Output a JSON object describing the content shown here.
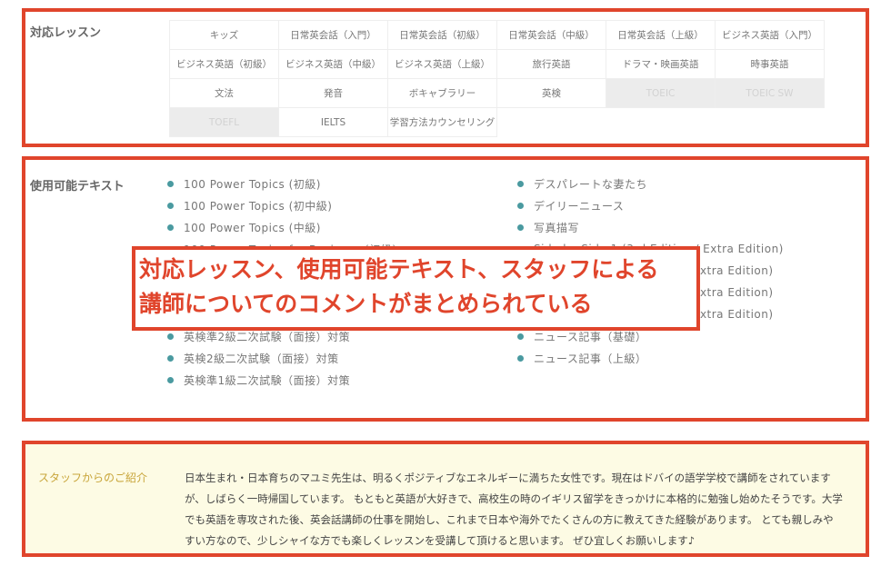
{
  "lessons": {
    "label": "対応レッスン",
    "items": [
      {
        "t": "キッズ",
        "on": true
      },
      {
        "t": "日常英会話（入門）",
        "on": true
      },
      {
        "t": "日常英会話（初級）",
        "on": true
      },
      {
        "t": "日常英会話（中級）",
        "on": true
      },
      {
        "t": "日常英会話（上級）",
        "on": true
      },
      {
        "t": "ビジネス英語（入門）",
        "on": true
      },
      {
        "t": "ビジネス英語（初級）",
        "on": true
      },
      {
        "t": "ビジネス英語（中級）",
        "on": true
      },
      {
        "t": "ビジネス英語（上級）",
        "on": true
      },
      {
        "t": "旅行英語",
        "on": true
      },
      {
        "t": "ドラマ・映画英語",
        "on": true
      },
      {
        "t": "時事英語",
        "on": true
      },
      {
        "t": "文法",
        "on": true
      },
      {
        "t": "発音",
        "on": true
      },
      {
        "t": "ボキャブラリー",
        "on": true
      },
      {
        "t": "英検",
        "on": true
      },
      {
        "t": "TOEIC",
        "on": false
      },
      {
        "t": "TOEIC SW",
        "on": false
      },
      {
        "t": "TOEFL",
        "on": false
      },
      {
        "t": "IELTS",
        "on": true
      },
      {
        "t": "学習方法カウンセリング",
        "on": true
      }
    ]
  },
  "texts": {
    "label": "使用可能テキスト",
    "left": [
      "100 Power Topics (初級)",
      "100 Power Topics (初中級)",
      "100 Power Topics (中級)",
      "100 Power Topics for Business (初級)",
      "",
      "",
      "",
      "英検準2級二次試験（面接）対策",
      "英検2級二次試験（面接）対策",
      "英検準1級二次試験（面接）対策"
    ],
    "right": [
      "デスパレートな妻たち",
      "デイリーニュース",
      "写真描写",
      "Side by Side 1 (3rd Edition / Extra Edition)",
      "/ Extra Edition)",
      "/ Extra Edition)",
      "/ Extra Edition)",
      "ニュース記事（基礎）",
      "ニュース記事（上級）"
    ]
  },
  "staff": {
    "label": "スタッフからのご紹介",
    "text": "日本生まれ・日本育ちのマユミ先生は、明るくポジティブなエネルギーに満ちた女性です。現在はドバイの語学学校で講師をされていますが、しばらく一時帰国しています。 もともと英語が大好きで、高校生の時のイギリス留学をきっかけに本格的に勉強し始めたそうです。大学でも英語を専攻された後、英会話講師の仕事を開始し、これまで日本や海外でたくさんの方に教えてきた経験があります。 とても親しみやすい方なので、少しシャイな方でも楽しくレッスンを受講して頂けると思います。 ぜひ宜しくお願いします♪"
  },
  "annotation": {
    "line1": "対応レッスン、使用可能テキスト、スタッフによる",
    "line2": "講師についてのコメントがまとめられている"
  },
  "colors": {
    "frame": "#e0452c",
    "bullet": "#4a9aa0",
    "staff_label": "#c8a53a",
    "staff_bg": "#fdfbe4"
  }
}
